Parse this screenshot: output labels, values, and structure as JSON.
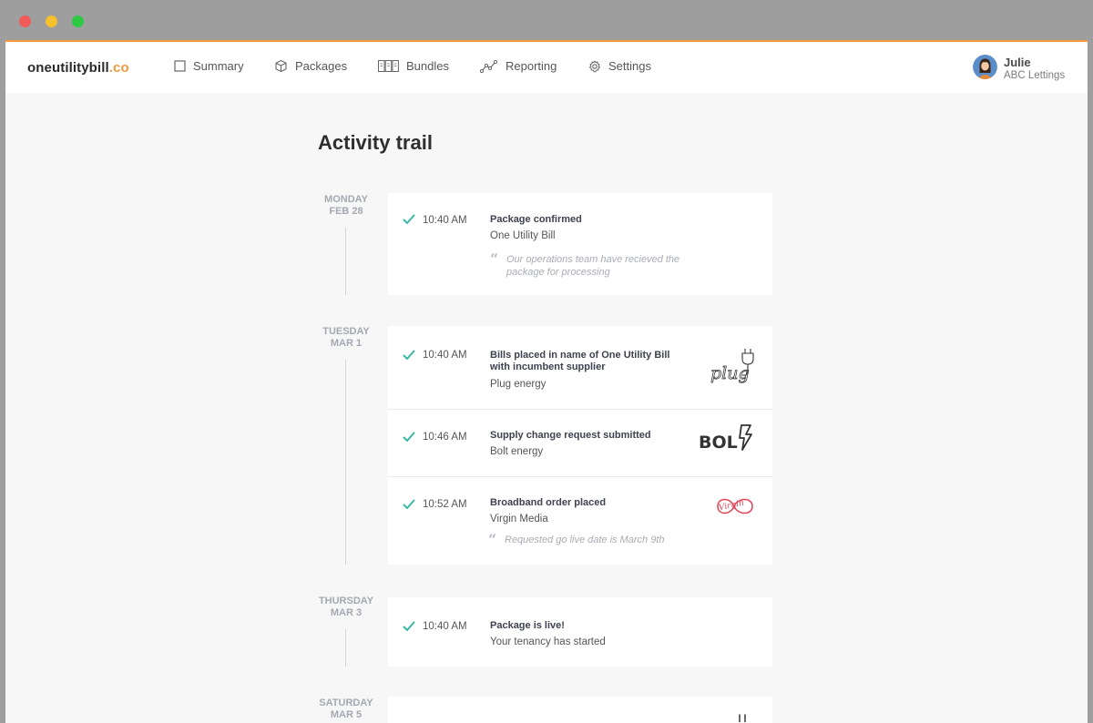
{
  "brand": {
    "name_main": "oneutilitybill",
    "name_accent": ".co"
  },
  "nav": {
    "items": [
      {
        "label": "Summary",
        "icon": "square-icon"
      },
      {
        "label": "Packages",
        "icon": "box-icon"
      },
      {
        "label": "Bundles",
        "icon": "bundles-icon"
      },
      {
        "label": "Reporting",
        "icon": "chart-line-icon"
      },
      {
        "label": "Settings",
        "icon": "gear-icon"
      }
    ]
  },
  "user": {
    "name": "Julie",
    "org": "ABC Lettings"
  },
  "page": {
    "title": "Activity trail"
  },
  "colors": {
    "accent": "#f39a3c",
    "check": "#3bb7a5",
    "virgin": "#e34256"
  },
  "days": [
    {
      "weekday": "MONDAY",
      "date": "FEB 28",
      "entries": [
        {
          "time": "10:40 AM",
          "title": "Package confirmed",
          "subtitle": "One Utility Bill",
          "quote": "Our operations team have recieved the package for processing"
        }
      ]
    },
    {
      "weekday": "TUESDAY",
      "date": "MAR 1",
      "entries": [
        {
          "time": "10:40 AM",
          "title": "Bills placed in name of One Utility Bill with incumbent supplier",
          "subtitle": "Plug energy",
          "supplier_logo": {
            "icon": "plug-logo-icon",
            "text": "plug"
          }
        },
        {
          "time": "10:46 AM",
          "title": "Supply change request submitted",
          "subtitle": "Bolt energy",
          "supplier_logo": {
            "icon": "bolt-logo-icon",
            "text": "BOL"
          }
        },
        {
          "time": "10:52 AM",
          "title": "Broadband order placed",
          "subtitle": "Virgin Media",
          "quote": "Requested go live date is March 9th",
          "supplier_logo": {
            "icon": "virgin-media-logo-icon",
            "text": "Virgin"
          }
        }
      ]
    },
    {
      "weekday": "THURSDAY",
      "date": "MAR 3",
      "entries": [
        {
          "time": "10:40 AM",
          "title": "Package is live!",
          "subtitle": "Your tenancy has started"
        }
      ]
    },
    {
      "weekday": "SATURDAY",
      "date": "MAR 5",
      "entries": []
    }
  ]
}
